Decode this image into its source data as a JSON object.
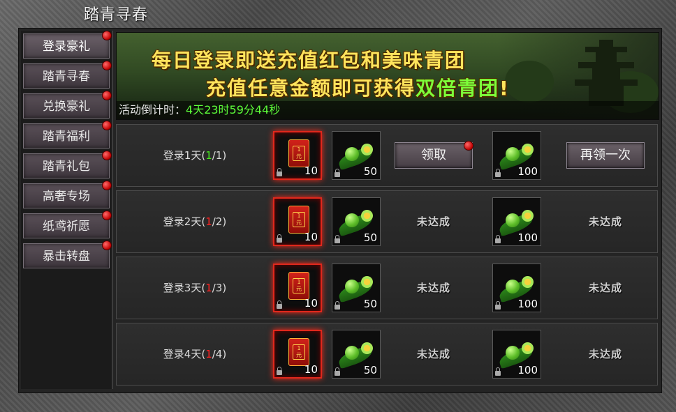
{
  "window": {
    "title": "踏青寻春"
  },
  "sidebar": {
    "items": [
      {
        "label": "登录豪礼",
        "active": true,
        "badge": true
      },
      {
        "label": "踏青寻春",
        "active": false,
        "badge": true
      },
      {
        "label": "兑换豪礼",
        "active": false,
        "badge": true
      },
      {
        "label": "踏青福利",
        "active": false,
        "badge": true
      },
      {
        "label": "踏青礼包",
        "active": false,
        "badge": true
      },
      {
        "label": "高奢专场",
        "active": false,
        "badge": true
      },
      {
        "label": "纸鸢祈愿",
        "active": false,
        "badge": true
      },
      {
        "label": "暴击转盘",
        "active": false,
        "badge": true
      }
    ]
  },
  "banner": {
    "line1": "每日登录即送充值红包和美味青团",
    "line2_a": "充值任意金额即可获得",
    "line2_b": "双倍青团",
    "line2_c": "!",
    "countdown_label": "活动倒计时：",
    "countdown_value": "4天23时59分44秒"
  },
  "rows": [
    {
      "label_pre": "登录1天(",
      "progress_done": "1",
      "progress_total": "/1)",
      "complete": true,
      "envelope_text": "1\n元",
      "envelope_count": "10",
      "qingtuan_count_1": "50",
      "qingtuan_count_2": "100",
      "action_1": "领取",
      "action_2": "再领一次"
    },
    {
      "label_pre": "登录2天(",
      "progress_done": "1",
      "progress_total": "/2)",
      "complete": false,
      "envelope_text": "1\n元",
      "envelope_count": "10",
      "qingtuan_count_1": "50",
      "qingtuan_count_2": "100",
      "action_1": "未达成",
      "action_2": "未达成"
    },
    {
      "label_pre": "登录3天(",
      "progress_done": "1",
      "progress_total": "/3)",
      "complete": false,
      "envelope_text": "1\n元",
      "envelope_count": "10",
      "qingtuan_count_1": "50",
      "qingtuan_count_2": "100",
      "action_1": "未达成",
      "action_2": "未达成"
    },
    {
      "label_pre": "登录4天(",
      "progress_done": "1",
      "progress_total": "/4)",
      "complete": false,
      "envelope_text": "1\n元",
      "envelope_count": "10",
      "qingtuan_count_1": "50",
      "qingtuan_count_2": "100",
      "action_1": "未达成",
      "action_2": "未达成"
    }
  ],
  "colors": {
    "progress_done": "#46e81d",
    "progress_pending": "#ff2020",
    "banner_text": "#ffe45c",
    "banner_highlight": "#7dff3a",
    "countdown": "#5dff3a"
  }
}
